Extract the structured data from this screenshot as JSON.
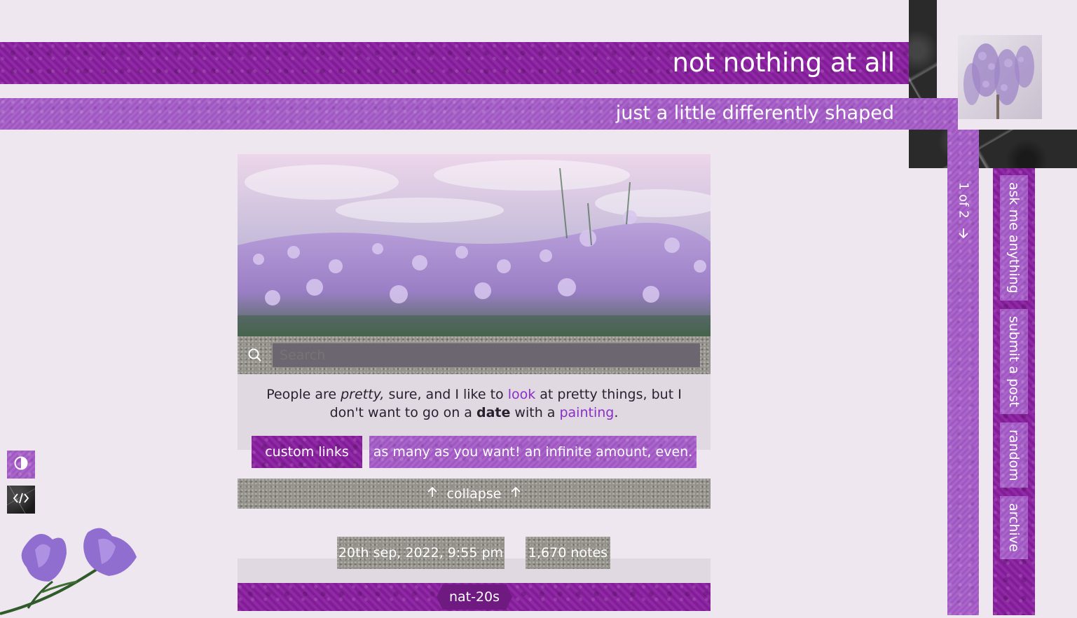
{
  "header": {
    "title": "not nothing at all",
    "subtitle": "just a little differently shaped"
  },
  "search": {
    "placeholder": "Search",
    "icon": "search-icon"
  },
  "description": {
    "t1": "People are ",
    "pretty": "pretty,",
    "t2": " sure, and I like to ",
    "look": "look",
    "t3": " at pretty things, but I don't want to go on a ",
    "date": "date",
    "t4": " with a ",
    "painting": "painting",
    "t5": "."
  },
  "custom_links": [
    {
      "label": "custom links"
    },
    {
      "label": "as many as you want! an infinite amount, even."
    }
  ],
  "collapse": {
    "label": "collapse",
    "icon": "arrow-up-icon"
  },
  "post": {
    "date": "20th sep, 2022, 9:55 pm",
    "notes": "1,670 notes",
    "author": "nat-20s"
  },
  "pagination": {
    "label": "1 of 2",
    "icon": "arrow-down-icon"
  },
  "nav": [
    {
      "label": "ask me anything"
    },
    {
      "label": "submit a post"
    },
    {
      "label": "random"
    },
    {
      "label": "archive"
    }
  ],
  "toggles": {
    "theme_icon": "contrast-icon",
    "code_icon": "code-icon"
  },
  "colors": {
    "background": "#efe7ef",
    "purple_dark": "#8a1ea0",
    "purple_light": "#a55cc8",
    "link": "#8a2ec8"
  }
}
